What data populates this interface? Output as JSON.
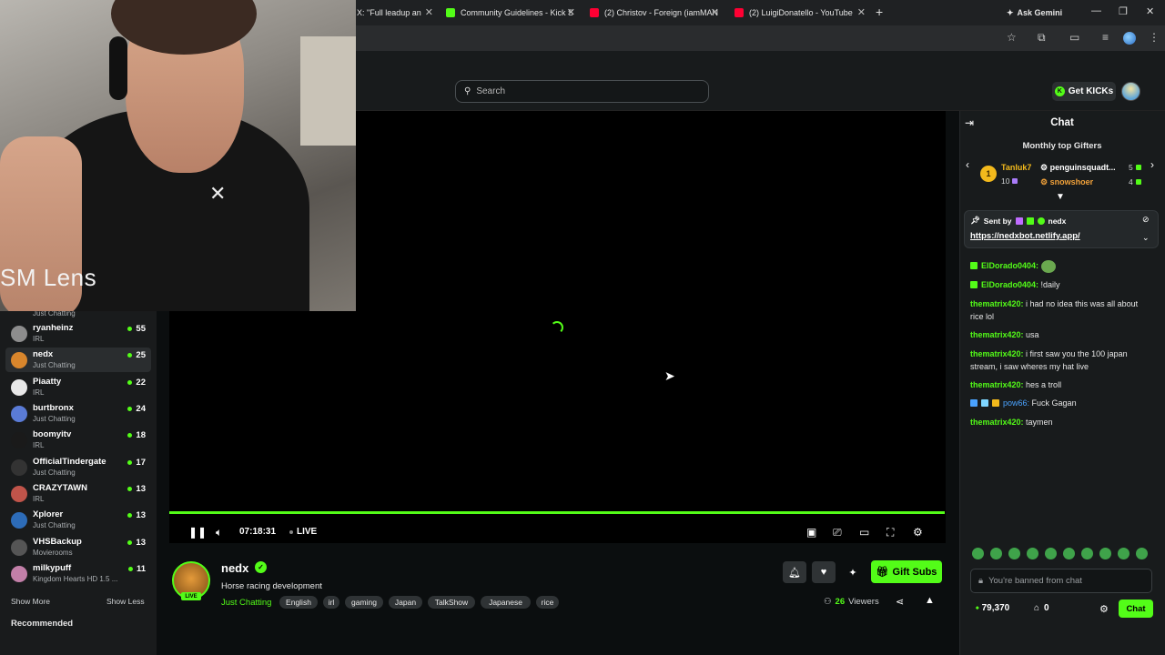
{
  "browser": {
    "tabs": [
      {
        "label": "X: \"Full leadup an",
        "color": "#1b1b1b"
      },
      {
        "label": "Community Guidelines - Kick S",
        "color": "#53fc18"
      },
      {
        "label": "(2) Christov - Foreign (iamMAN",
        "color": "#ff0033"
      },
      {
        "label": "(2) LuigiDonatello - YouTube",
        "color": "#ff0033"
      }
    ],
    "gemini_label": "Ask Gemini"
  },
  "header": {
    "search_placeholder": "Search",
    "get_kicks_label": "Get KICKs"
  },
  "webcam": {
    "lens_label": "SM Lens"
  },
  "sidebar": {
    "top_category": "Just Chatting",
    "channels": [
      {
        "name": "ryanheinz",
        "category": "IRL",
        "viewers": "55",
        "avatar_color": "#8d8d8d"
      },
      {
        "name": "nedx",
        "category": "Just Chatting",
        "viewers": "25",
        "avatar_color": "#d9862c",
        "active": true
      },
      {
        "name": "Piaatty",
        "category": "IRL",
        "viewers": "22",
        "avatar_color": "#e8e8e8"
      },
      {
        "name": "burtbronx",
        "category": "Just Chatting",
        "viewers": "24",
        "avatar_color": "#5a7bd6"
      },
      {
        "name": "boomyitv",
        "category": "IRL",
        "viewers": "18",
        "avatar_color": "#1a1a1a"
      },
      {
        "name": "OfficialTindergate",
        "category": "Just Chatting",
        "viewers": "17",
        "avatar_color": "#333333"
      },
      {
        "name": "CRAZYTAWN",
        "category": "IRL",
        "viewers": "13",
        "avatar_color": "#c0544a"
      },
      {
        "name": "Xplorer",
        "category": "Just Chatting",
        "viewers": "13",
        "avatar_color": "#2d6cb8"
      },
      {
        "name": "VHSBackup",
        "category": "Movierooms",
        "viewers": "13",
        "avatar_color": "#555555"
      },
      {
        "name": "milkypuff",
        "category": "Kingdom Hearts HD 1.5 ...",
        "viewers": "11",
        "avatar_color": "#c27fa8"
      }
    ],
    "show_more": "Show More",
    "show_less": "Show Less",
    "recommended": "Recommended"
  },
  "player": {
    "progress": 1.0,
    "timecode": "07:18:31",
    "live_label": "LIVE"
  },
  "stream": {
    "channel_name": "nedx",
    "live_badge": "LIVE",
    "title": "Horse racing development",
    "category": "Just Chatting",
    "tags": [
      "English",
      "irl",
      "gaming",
      "Japan",
      "TalkShow",
      "Japanese",
      "rice"
    ],
    "gift_subs_label": "Gift Subs",
    "viewers_count": "26",
    "viewers_label": "Viewers"
  },
  "chat": {
    "title": "Chat",
    "gifters_title": "Monthly top Gifters",
    "gifters": [
      {
        "name": "Tanluk7",
        "count": "10",
        "color": "#f2b91c"
      },
      {
        "name": "penguinsquadt...",
        "count": "5",
        "color": "#ffffff"
      },
      {
        "name": "snowshoer",
        "count": "4",
        "color": "#f2a23a"
      }
    ],
    "pinned": {
      "sent_by_label": "Sent by",
      "sender": "nedx",
      "link": "https://nedxbot.netlify.app/"
    },
    "messages": [
      {
        "user": "ElDorado0404:",
        "text": "",
        "color": "#53fc18",
        "emote": true
      },
      {
        "user": "ElDorado0404:",
        "text": "!daily",
        "color": "#53fc18"
      },
      {
        "user": "thematrix420:",
        "text": "i had no idea this was all about rice lol",
        "color": "#53fc18"
      },
      {
        "user": "thematrix420:",
        "text": "usa",
        "color": "#53fc18"
      },
      {
        "user": "thematrix420:",
        "text": "i first saw you the 100 japan stream, i saw wheres my hat live",
        "color": "#53fc18"
      },
      {
        "user": "thematrix420:",
        "text": "hes a troll",
        "color": "#53fc18"
      },
      {
        "user": "pow66:",
        "text": "Fuck Gagan",
        "color": "#4aa3ff"
      },
      {
        "user": "thematrix420:",
        "text": "taymen",
        "color": "#53fc18"
      }
    ],
    "banned_placeholder": "You're banned from chat",
    "points": "79,370",
    "shop_count": "0",
    "chat_button": "Chat"
  },
  "colors": {
    "accent": "#53fc18",
    "background": "#0b0e0f",
    "sidebar": "#191b1c"
  }
}
